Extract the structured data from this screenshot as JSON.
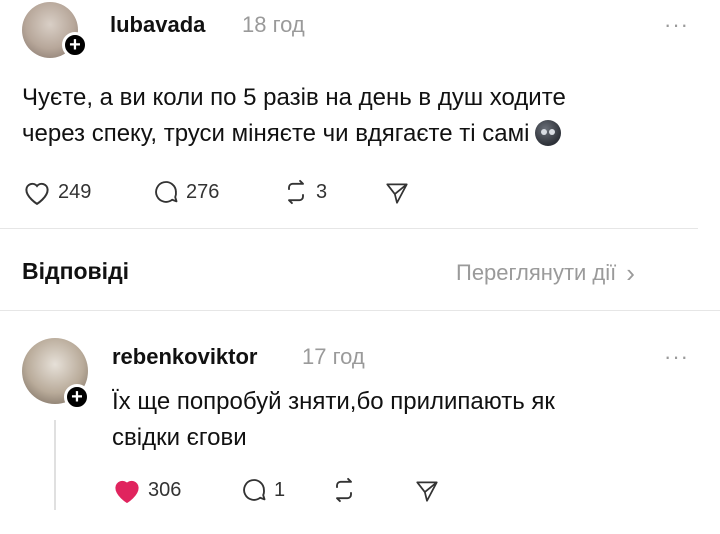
{
  "post": {
    "username": "lubavada",
    "time": "18 год",
    "more_label": "···",
    "text_line1": "Чуєте, а ви коли по 5 разів на день в душ ходите",
    "text_line2": "через спеку, труси міняєте чи вдягаєте ті самі",
    "emoji_icon": "dizzy-face-emoji",
    "likes": "249",
    "comments": "276",
    "reposts": "3"
  },
  "replies_section": {
    "title": "Відповіді",
    "view_activity": "Переглянути дії",
    "chevron": "›"
  },
  "reply": {
    "username": "rebenkoviktor",
    "time": "17 год",
    "more_label": "···",
    "text_line1": "Їх ще попробуй зняти,бо прилипають як",
    "text_line2": "свідки єгови",
    "likes": "306",
    "liked": true,
    "comments": "1"
  },
  "colors": {
    "like_active": "#e0245e",
    "muted": "#9a9a9a"
  }
}
